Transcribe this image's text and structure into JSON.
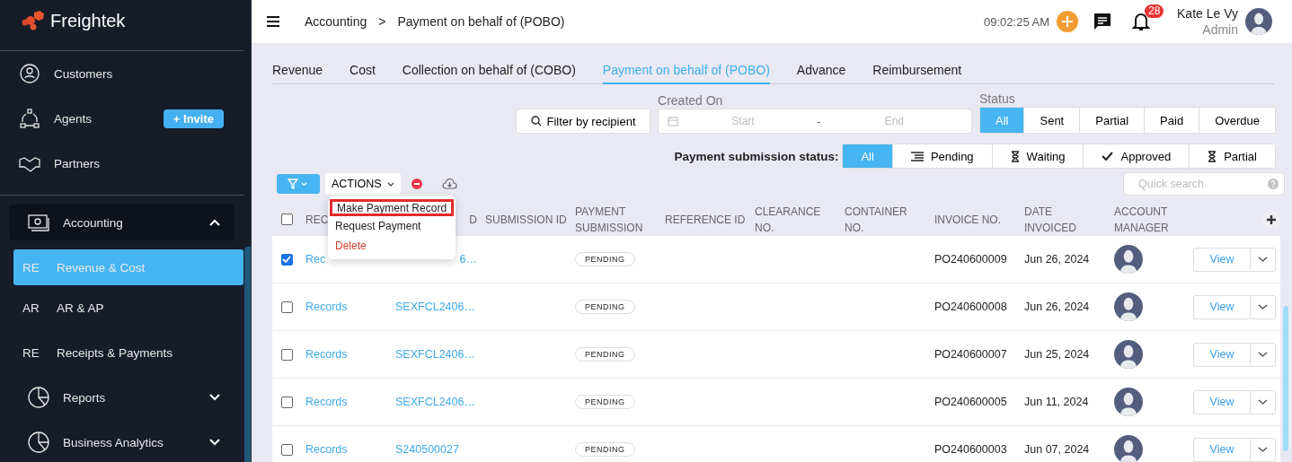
{
  "sidebar": {
    "brand": "Freightek",
    "items": [
      {
        "label": "Customers"
      },
      {
        "label": "Agents",
        "action": "+ Invite"
      },
      {
        "label": "Partners"
      }
    ],
    "groups": [
      {
        "label": "Accounting",
        "expanded": true,
        "children": [
          {
            "abbr": "RE",
            "label": "Revenue & Cost",
            "selected": true
          },
          {
            "abbr": "AR",
            "label": "AR & AP",
            "selected": false
          },
          {
            "abbr": "RE",
            "label": "Receipts & Payments",
            "selected": false
          }
        ]
      },
      {
        "label": "Reports",
        "expanded": false
      },
      {
        "label": "Business Analytics",
        "expanded": false
      }
    ]
  },
  "header": {
    "breadcrumb": [
      "Accounting",
      "Payment on behalf of (POBO)"
    ],
    "separator": ">",
    "time": "09:02:25 AM",
    "notifications": "28",
    "user": {
      "name": "Kate Le Vy",
      "role": "Admin"
    }
  },
  "tabs": [
    {
      "label": "Revenue",
      "selected": false
    },
    {
      "label": "Cost",
      "selected": false
    },
    {
      "label": "Collection on behalf of (COBO)",
      "selected": false
    },
    {
      "label": "Payment on behalf of (POBO)",
      "selected": true
    },
    {
      "label": "Advance",
      "selected": false
    },
    {
      "label": "Reimbursement",
      "selected": false
    }
  ],
  "filters": {
    "recipient_button": "Filter by recipient",
    "created_on": {
      "label": "Created On",
      "start_placeholder": "Start",
      "separator": "-",
      "end_placeholder": "End"
    },
    "status": {
      "label": "Status",
      "options": [
        {
          "label": "All",
          "selected": true
        },
        {
          "label": "Sent",
          "selected": false
        },
        {
          "label": "Partial",
          "selected": false
        },
        {
          "label": "Paid",
          "selected": false
        },
        {
          "label": "Overdue",
          "selected": false
        }
      ]
    },
    "submission_status": {
      "label": "Payment submission status:",
      "options": [
        {
          "label": "All",
          "kind": "plain",
          "selected": true
        },
        {
          "label": "Pending",
          "kind": "list",
          "selected": false
        },
        {
          "label": "Waiting",
          "kind": "hourglass",
          "selected": false
        },
        {
          "label": "Approved",
          "kind": "check",
          "selected": false
        },
        {
          "label": "Partial",
          "kind": "hourglass",
          "selected": false
        }
      ]
    }
  },
  "toolbar": {
    "actions_label": "ACTIONS",
    "quick_search": {
      "placeholder": "Quick search"
    }
  },
  "actions_menu": {
    "open": true,
    "items": [
      {
        "label": "Make Payment Record",
        "kind": "normal",
        "highlighted": true
      },
      {
        "label": "Request Payment",
        "kind": "normal",
        "highlighted": false
      },
      {
        "label": "Delete",
        "kind": "danger",
        "highlighted": false
      }
    ]
  },
  "table": {
    "all_checked": false,
    "columns": [
      "REC",
      "D",
      "SUBMISSION ID",
      "PAYMENT SUBMISSION",
      "REFERENCE ID",
      "CLEARANCE NO.",
      "CONTAINER NO.",
      "INVOICE NO.",
      "DATE INVOICED",
      "ACCOUNT MANAGER"
    ],
    "rows": [
      {
        "checked": true,
        "record": "Rec",
        "shipment": "6…",
        "submission": "PENDING",
        "invoice": "PO240600009",
        "date": "Jun 26, 2024",
        "action": "View"
      },
      {
        "checked": false,
        "record": "Records",
        "shipment": "SEXFCL2406…",
        "submission": "PENDING",
        "invoice": "PO240600008",
        "date": "Jun 26, 2024",
        "action": "View"
      },
      {
        "checked": false,
        "record": "Records",
        "shipment": "SEXFCL2406…",
        "submission": "PENDING",
        "invoice": "PO240600007",
        "date": "Jun 25, 2024",
        "action": "View"
      },
      {
        "checked": false,
        "record": "Records",
        "shipment": "SEXFCL2406…",
        "submission": "PENDING",
        "invoice": "PO240600005",
        "date": "Jun 11, 2024",
        "action": "View"
      },
      {
        "checked": false,
        "record": "Records",
        "shipment": "S240500027",
        "submission": "PENDING",
        "invoice": "PO240600003",
        "date": "Jun 07, 2024",
        "action": "View"
      }
    ]
  }
}
